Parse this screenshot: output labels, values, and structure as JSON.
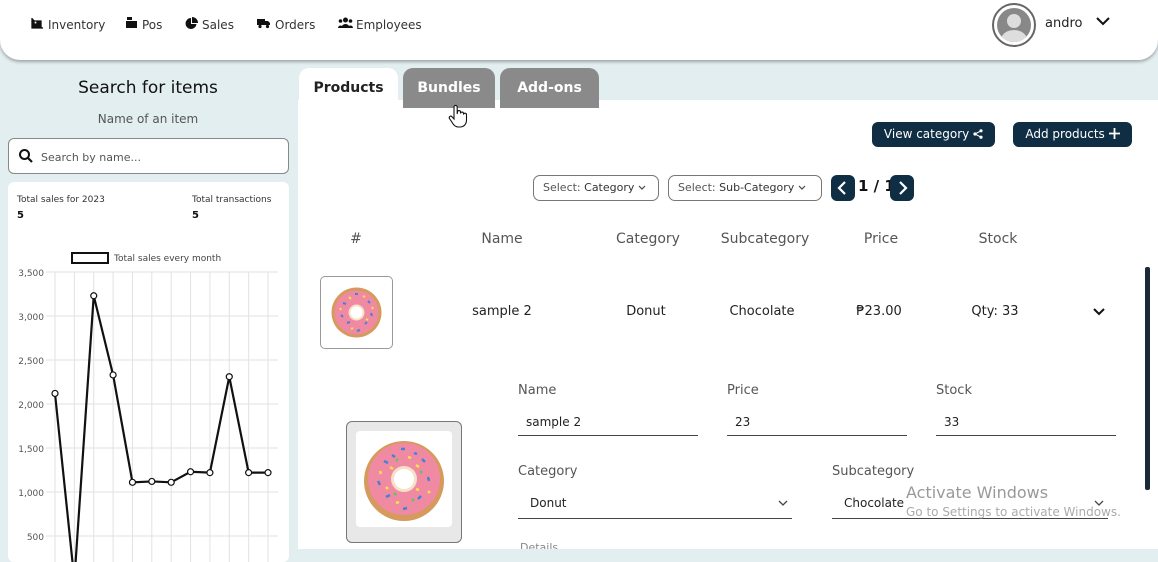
{
  "nav": [
    {
      "label": "Inventory",
      "icon": "warehouse-icon"
    },
    {
      "label": "Pos",
      "icon": "cash-register-icon"
    },
    {
      "label": "Sales",
      "icon": "pie-chart-icon"
    },
    {
      "label": "Orders",
      "icon": "truck-icon"
    },
    {
      "label": "Employees",
      "icon": "users-icon"
    }
  ],
  "user": {
    "name": "andro"
  },
  "search": {
    "title": "Search for items",
    "subtitle": "Name of an item",
    "placeholder": "Search by name..."
  },
  "stats": {
    "sales_label": "Total sales for 2023",
    "sales_value": "5",
    "tx_label": "Total transactions",
    "tx_value": "5"
  },
  "chart_data": {
    "type": "line",
    "series": [
      {
        "name": "Total sales every month",
        "values": [
          2120,
          0,
          3230,
          2330,
          1110,
          1120,
          1110,
          1230,
          1220,
          2310,
          1220,
          1220
        ]
      }
    ],
    "ylim": [
      300,
      3500
    ],
    "yticks": [
      "3,500",
      "3,000",
      "2,500",
      "2,000",
      "1,500",
      "1,000",
      "500"
    ],
    "grid": true,
    "legend": "top"
  },
  "tabs": {
    "products": "Products",
    "bundles": "Bundles",
    "addons": "Add-ons"
  },
  "actions": {
    "view_category": "View category",
    "add_products": "Add products"
  },
  "filters": {
    "category_prefix": "Select:",
    "category": "Category",
    "subcategory_prefix": "Select:",
    "subcategory": "Sub-Category"
  },
  "pagination": {
    "indicator": "1 / 1"
  },
  "table": {
    "headers": {
      "num": "#",
      "name": "Name",
      "category": "Category",
      "subcategory": "Subcategory",
      "price": "Price",
      "stock": "Stock"
    },
    "row": {
      "name": "sample 2",
      "category": "Donut",
      "subcategory": "Chocolate",
      "price": "₱23.00",
      "stock": "Qty: 33"
    }
  },
  "edit": {
    "name_label": "Name",
    "name_value": "sample 2",
    "price_label": "Price",
    "price_value": "23",
    "stock_label": "Stock",
    "stock_value": "33",
    "category_label": "Category",
    "category_value": "Donut",
    "subcategory_label": "Subcategory",
    "subcategory_value": "Chocolate",
    "details_label": "Details"
  },
  "watermark": {
    "line1": "Activate Windows",
    "line2": "Go to Settings to activate Windows."
  },
  "colors": {
    "accent": "#0f2e44",
    "tab_inactive": "#8a8a8a",
    "background": "#e3eef0"
  }
}
